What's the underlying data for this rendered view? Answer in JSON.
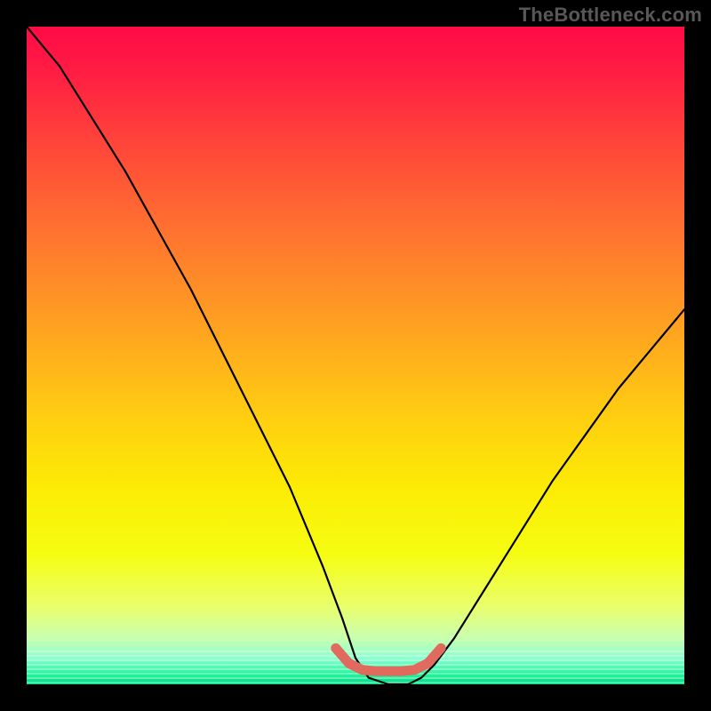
{
  "watermark": "TheBottleneck.com",
  "chart_data": {
    "type": "line",
    "title": "",
    "xlabel": "",
    "ylabel": "",
    "xlim": [
      0,
      100
    ],
    "ylim": [
      0,
      100
    ],
    "series": [
      {
        "name": "black-curve",
        "color": "#000000",
        "x": [
          0,
          5,
          10,
          15,
          20,
          25,
          30,
          35,
          40,
          45,
          48,
          50,
          52,
          55,
          58,
          60,
          62,
          65,
          70,
          75,
          80,
          85,
          90,
          95,
          100
        ],
        "y": [
          100,
          94,
          86,
          78,
          69,
          60,
          50,
          40,
          30,
          18,
          10,
          4,
          1,
          0,
          0,
          1,
          3,
          7,
          15,
          23,
          31,
          38,
          45,
          51,
          57
        ]
      },
      {
        "name": "coral-flat-segment",
        "color": "#e16a5f",
        "x": [
          47,
          49,
          51,
          53,
          55,
          57,
          59,
          61,
          63
        ],
        "y": [
          5.5,
          3.2,
          2.2,
          2.0,
          2.0,
          2.0,
          2.2,
          3.2,
          5.5
        ]
      }
    ],
    "background_gradient": {
      "top": "#ff0b46",
      "upper_mid": "#ffa61f",
      "mid": "#fceb05",
      "lower_mid": "#eaff6a",
      "bottom": "#00d884"
    }
  }
}
